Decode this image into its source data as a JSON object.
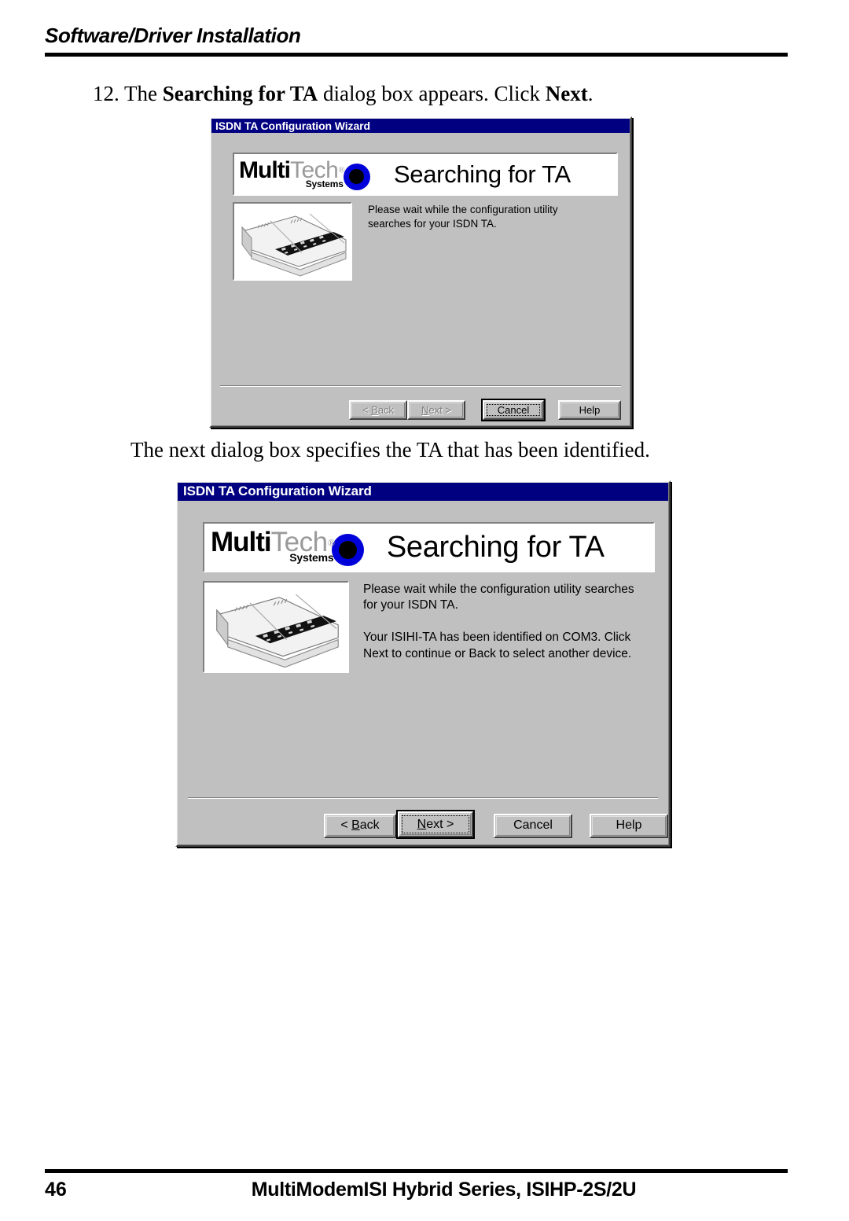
{
  "page": {
    "header_title": "Software/Driver Installation",
    "footer_page_number": "46",
    "footer_doc_title": "MultiModemISI Hybrid Series, ISIHP-2S/2U"
  },
  "instructions": {
    "step_number": "12.",
    "step_line_pre": " The ",
    "step_line_bold1": "Searching for TA",
    "step_line_mid": " dialog box appears. Click ",
    "step_line_bold2": "Next",
    "step_line_end": ".",
    "next_caption": "The next dialog box specifies the TA that has been identified."
  },
  "logo": {
    "multi": "Multi",
    "tech": "Tech",
    "registered": "®",
    "systems": "Systems",
    "ring_color": "#0000d8",
    "core_color": "#000000"
  },
  "dialog1": {
    "titlebar": "ISDN TA Configuration Wizard",
    "banner_title": "Searching for TA",
    "body_paragraphs": [
      "Please wait while the configuration utility searches for your ISDN TA."
    ],
    "device_image_alt": "isdn-ta-device-illustration",
    "buttons": [
      {
        "label_pre": "< ",
        "label_accel": "B",
        "label_post": "ack",
        "name": "back-button",
        "state": "disabled",
        "default": false
      },
      {
        "label_pre": "",
        "label_accel": "N",
        "label_post": "ext >",
        "name": "next-button",
        "state": "disabled",
        "default": false
      },
      {
        "label_pre": "Cancel",
        "label_accel": "",
        "label_post": "",
        "name": "cancel-button",
        "state": "enabled",
        "default": true
      },
      {
        "label_pre": "Help",
        "label_accel": "",
        "label_post": "",
        "name": "help-button",
        "state": "enabled",
        "default": false
      }
    ]
  },
  "dialog2": {
    "titlebar": "ISDN TA Configuration Wizard",
    "banner_title": "Searching for TA",
    "body_paragraphs": [
      "Please wait while the configuration utility searches for your ISDN TA.",
      "Your ISIHI-TA has been identified on COM3. Click Next to continue or Back to select another device."
    ],
    "device_image_alt": "isdn-ta-device-illustration",
    "buttons": [
      {
        "label_pre": "< ",
        "label_accel": "B",
        "label_post": "ack",
        "name": "back-button",
        "state": "enabled",
        "default": false
      },
      {
        "label_pre": "",
        "label_accel": "N",
        "label_post": "ext >",
        "name": "next-button",
        "state": "enabled",
        "default": true
      },
      {
        "label_pre": "Cancel",
        "label_accel": "",
        "label_post": "",
        "name": "cancel-button",
        "state": "enabled",
        "default": false
      },
      {
        "label_pre": "Help",
        "label_accel": "",
        "label_post": "",
        "name": "help-button",
        "state": "enabled",
        "default": false
      }
    ]
  },
  "colors": {
    "titlebar_bg": "#000080",
    "dialog_face": "#c0c0c0",
    "banner_bg": "#ffffff"
  }
}
